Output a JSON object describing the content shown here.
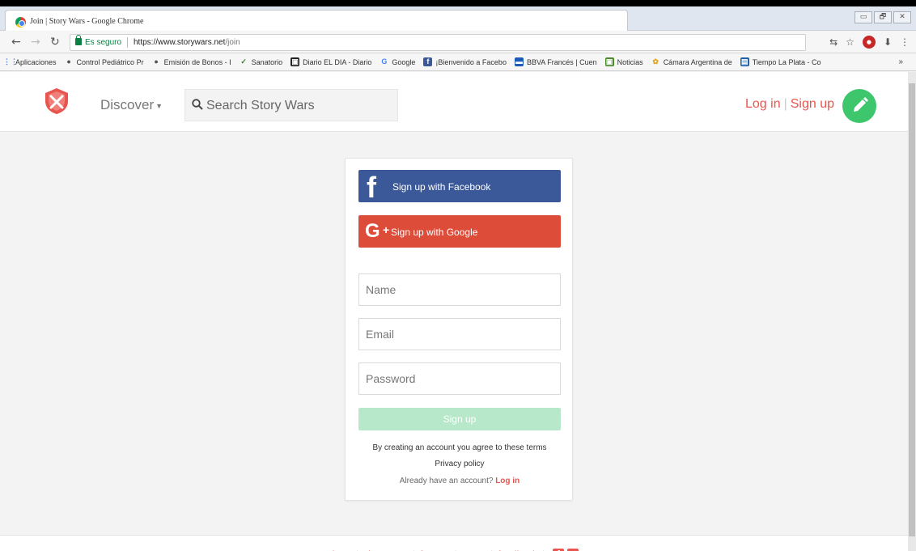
{
  "browser": {
    "window_title": "Join | Story Wars - Google Chrome",
    "secure_label": "Es seguro",
    "url_host": "https://www.storywars.net",
    "url_path": "/join",
    "window_buttons": [
      "▭",
      "🗗",
      "✕"
    ],
    "bookmarks": [
      {
        "label": "Aplicaciones",
        "icon": "apps-grid-icon",
        "color": "#4a7fd6"
      },
      {
        "label": "Control Pediátrico Pr",
        "icon": "bookmark-icon",
        "color": "#555555"
      },
      {
        "label": "Emisión de Bonos - I",
        "icon": "bookmark-icon",
        "color": "#555555"
      },
      {
        "label": "Sanatorio",
        "icon": "check-icon",
        "color": "#3a7d2f"
      },
      {
        "label": "Diario EL DIA - Diario",
        "icon": "news-icon",
        "color": "#222222"
      },
      {
        "label": "Google",
        "icon": "google-icon",
        "color": "#4285f4"
      },
      {
        "label": "¡Bienvenido a Facebo",
        "icon": "facebook-icon",
        "color": "#3b5998"
      },
      {
        "label": "BBVA Francés | Cuen",
        "icon": "bank-icon",
        "color": "#1a5ab8"
      },
      {
        "label": "Noticias",
        "icon": "news-icon",
        "color": "#4c8a2e"
      },
      {
        "label": "Cámara Argentina de",
        "icon": "globe-icon",
        "color": "#e0a320"
      },
      {
        "label": "Tiempo La Plata - Co",
        "icon": "weather-icon",
        "color": "#1f5fa8"
      }
    ],
    "more_bookmarks": "»"
  },
  "header": {
    "discover_label": "Discover",
    "search_placeholder": "Search Story Wars",
    "login_label": "Log in",
    "signup_label": "Sign up"
  },
  "signup": {
    "facebook_label": "Sign up with Facebook",
    "google_label": "Sign up with Google",
    "name_placeholder": "Name",
    "email_placeholder": "Email",
    "password_placeholder": "Password",
    "submit_label": "Sign up",
    "terms_text": "By creating an account you agree to these terms",
    "privacy_text": "Privacy policy",
    "already_text": "Already have an account?",
    "login_link": "Log in"
  },
  "footer": {
    "links": [
      "about",
      "classroom",
      "forums",
      "users",
      "feedback"
    ]
  },
  "colors": {
    "accent_red": "#e8554e",
    "facebook": "#3b5998",
    "google": "#dd4b39",
    "green": "#3ec66c",
    "signup_disabled": "#b6e8c9"
  }
}
